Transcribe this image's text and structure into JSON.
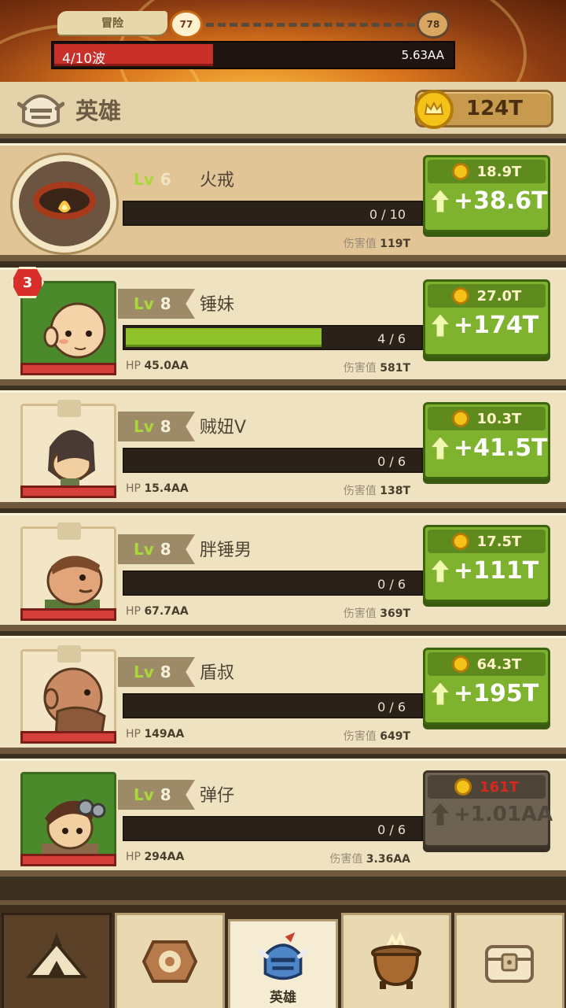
{
  "adventure": {
    "stage_tab": "冒险",
    "stage_from": "77",
    "stage_to": "78",
    "wave_text": "4/10波",
    "wave_progress": 0.4,
    "boss_hp": "5.63AA"
  },
  "header": {
    "title": "英雄",
    "gold": "124T",
    "icon": "knight-helmet-icon"
  },
  "heroes": [
    {
      "level_prefix": "Lv",
      "level": "6",
      "name": "火戒",
      "progress_text": "0 / 10",
      "progress": 0.0,
      "hp_label": "",
      "hp": "",
      "dmg_label": "伤害值",
      "dmg": "119T",
      "cost": "18.9T",
      "gain": "+38.6T",
      "badge": "",
      "affordable": true,
      "portrait": "fire-ring-icon"
    },
    {
      "level_prefix": "Lv",
      "level": "8",
      "name": "锤妹",
      "progress_text": "4 / 6",
      "progress": 0.667,
      "hp_label": "HP",
      "hp": "45.0AA",
      "dmg_label": "伤害值",
      "dmg": "581T",
      "cost": "27.0T",
      "gain": "+174T",
      "badge": "3",
      "affordable": true,
      "portrait": "bald-girl-portrait"
    },
    {
      "level_prefix": "Lv",
      "level": "8",
      "name": "贼妞V",
      "progress_text": "0 / 6",
      "progress": 0.0,
      "hp_label": "HP",
      "hp": "15.4AA",
      "dmg_label": "伤害值",
      "dmg": "138T",
      "cost": "10.3T",
      "gain": "+41.5T",
      "badge": "",
      "affordable": true,
      "portrait": "thief-girl-portrait"
    },
    {
      "level_prefix": "Lv",
      "level": "8",
      "name": "胖锤男",
      "progress_text": "0 / 6",
      "progress": 0.0,
      "hp_label": "HP",
      "hp": "67.7AA",
      "dmg_label": "伤害值",
      "dmg": "369T",
      "cost": "17.5T",
      "gain": "+111T",
      "badge": "",
      "affordable": true,
      "portrait": "fat-hammer-man-portrait"
    },
    {
      "level_prefix": "Lv",
      "level": "8",
      "name": "盾叔",
      "progress_text": "0 / 6",
      "progress": 0.0,
      "hp_label": "HP",
      "hp": "149AA",
      "dmg_label": "伤害值",
      "dmg": "649T",
      "cost": "64.3T",
      "gain": "+195T",
      "badge": "",
      "affordable": true,
      "portrait": "shield-uncle-portrait"
    },
    {
      "level_prefix": "Lv",
      "level": "8",
      "name": "弹仔",
      "progress_text": "0 / 6",
      "progress": 0.0,
      "hp_label": "HP",
      "hp": "294AA",
      "dmg_label": "伤害值",
      "dmg": "3.36AA",
      "cost": "161T",
      "gain": "+1.01AA",
      "badge": "",
      "affordable": false,
      "portrait": "slingshot-boy-portrait"
    }
  ],
  "nav": {
    "tabs": [
      {
        "icon": "camp-tent-icon",
        "label": ""
      },
      {
        "icon": "shop-badge-icon",
        "label": ""
      },
      {
        "icon": "knight-helmet-icon",
        "label": "英雄"
      },
      {
        "icon": "cauldron-icon",
        "label": ""
      },
      {
        "icon": "treasure-chest-icon",
        "label": ""
      }
    ]
  },
  "colors": {
    "upgrade_green": "#7fb22e",
    "upgrade_disabled": "#6e6253",
    "level_green": "#a8d93a",
    "hp_red": "#d5413a",
    "gold": "#f5c21a"
  }
}
